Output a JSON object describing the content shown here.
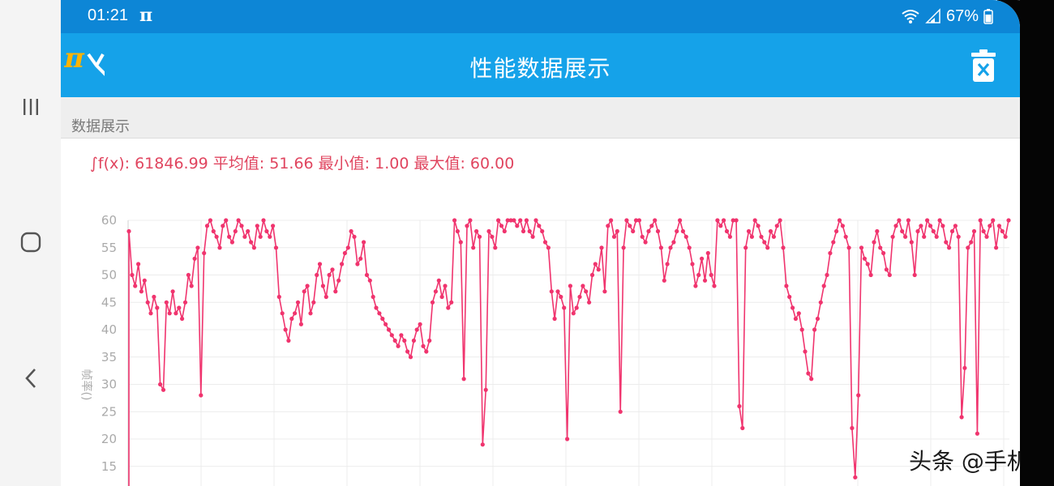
{
  "status_bar": {
    "time": "01:21",
    "app_indicator": "π",
    "battery_text": "67%",
    "icons": [
      "wifi-icon",
      "signal-icon",
      "battery-icon"
    ]
  },
  "app_bar": {
    "title": "性能数据展示",
    "logo_text": "π",
    "logo_icon": "perfdog-logo-icon",
    "delete_icon": "trash-icon"
  },
  "section": {
    "title": "数据展示"
  },
  "stats": {
    "integral": "∫f(x): 61846.99",
    "avg": "平均值: 51.66",
    "min": "最小值: 1.00",
    "max": "最大值: 60.00"
  },
  "nav_bar": {
    "icons": [
      "recents-icon",
      "home-icon",
      "back-icon"
    ]
  },
  "watermark": "头条 @手机之家",
  "colors": {
    "status_bar": "#0d86d6",
    "app_bar": "#15a2e9",
    "series": "#f0346e",
    "stats_text": "#e0455f"
  },
  "chart_data": {
    "type": "line",
    "ylabel": "帧率()",
    "ylim": [
      12,
      60
    ],
    "yticks": [
      15,
      20,
      25,
      30,
      35,
      40,
      45,
      50,
      55,
      60
    ],
    "grid": true,
    "series": [
      {
        "values": [
          58,
          50,
          48,
          52,
          47,
          49,
          45,
          43,
          46,
          44,
          30,
          29,
          45,
          43,
          47,
          43,
          44,
          42,
          45,
          50,
          48,
          53,
          55,
          28,
          54,
          59,
          60,
          58,
          57,
          55,
          59,
          60,
          57,
          56,
          58,
          60,
          59,
          57,
          58,
          56,
          55,
          59,
          57,
          60,
          58,
          57,
          59,
          55,
          46,
          43,
          40,
          38,
          42,
          43,
          45,
          41,
          47,
          48,
          43,
          45,
          50,
          52,
          48,
          46,
          50,
          51,
          47,
          49,
          52,
          54,
          55,
          58,
          57,
          52,
          53,
          56,
          50,
          49,
          46,
          44,
          43,
          42,
          41,
          40,
          39,
          38,
          37,
          39,
          38,
          36,
          35,
          38,
          40,
          41,
          37,
          36,
          38,
          45,
          47,
          49,
          46,
          48,
          44,
          45,
          60,
          58,
          56,
          31,
          59,
          60,
          55,
          58,
          57,
          19,
          29,
          58,
          57,
          55,
          60,
          59,
          58,
          60,
          60,
          60,
          59,
          60,
          58,
          60,
          58,
          57,
          60,
          59,
          58,
          56,
          55,
          47,
          42,
          47,
          46,
          44,
          20,
          48,
          43,
          44,
          46,
          48,
          47,
          45,
          50,
          52,
          51,
          55,
          47,
          59,
          60,
          57,
          58,
          25,
          55,
          60,
          59,
          58,
          60,
          60,
          57,
          56,
          58,
          59,
          60,
          58,
          55,
          49,
          52,
          55,
          56,
          58,
          60,
          58,
          57,
          55,
          52,
          48,
          50,
          53,
          49,
          54,
          50,
          48,
          60,
          59,
          60,
          58,
          57,
          60,
          60,
          26,
          22,
          55,
          58,
          57,
          60,
          59,
          57,
          56,
          55,
          58,
          57,
          59,
          60,
          55,
          48,
          46,
          44,
          42,
          43,
          40,
          36,
          32,
          31,
          40,
          42,
          45,
          48,
          50,
          54,
          56,
          58,
          60,
          59,
          57,
          55,
          22,
          13,
          28,
          55,
          53,
          52,
          50,
          56,
          58,
          55,
          54,
          51,
          50,
          57,
          59,
          60,
          58,
          57,
          60,
          56,
          50,
          58,
          59,
          57,
          60,
          59,
          58,
          57,
          60,
          59,
          56,
          55,
          58,
          59,
          57,
          24,
          33,
          55,
          56,
          58,
          21,
          60,
          58,
          57,
          59,
          60,
          55,
          59,
          58,
          57,
          60
        ]
      }
    ]
  }
}
